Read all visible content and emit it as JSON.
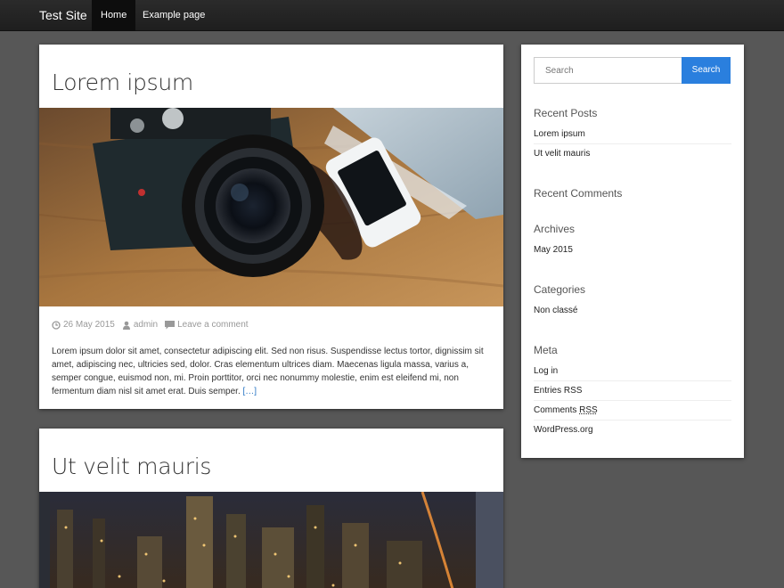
{
  "nav": {
    "brand": "Test Site",
    "items": [
      "Home",
      "Example page"
    ]
  },
  "posts": [
    {
      "title": "Lorem ipsum",
      "date": "26 May 2015",
      "author": "admin",
      "comments": "Leave a comment",
      "excerpt": "Lorem ipsum dolor sit amet, consectetur adipiscing elit. Sed non risus. Suspendisse lectus tortor, dignissim sit amet, adipiscing nec, ultricies sed, dolor. Cras elementum ultrices diam. Maecenas ligula massa, varius a, semper congue, euismod non, mi. Proin porttitor, orci nec nonummy molestie, enim est eleifend mi, non fermentum diam nisl sit amet erat. Duis semper.",
      "more": "[…]"
    },
    {
      "title": "Ut velit mauris"
    }
  ],
  "sidebar": {
    "search_placeholder": "Search",
    "search_button": "Search",
    "recent_posts_title": "Recent Posts",
    "recent_posts": [
      "Lorem ipsum",
      "Ut velit mauris"
    ],
    "recent_comments_title": "Recent Comments",
    "archives_title": "Archives",
    "archives": [
      "May 2015"
    ],
    "categories_title": "Categories",
    "categories": [
      "Non classé"
    ],
    "meta_title": "Meta",
    "meta_links": [
      "Log in",
      "Entries RSS",
      "Comments",
      "RSS",
      "WordPress.org"
    ]
  },
  "colors": {
    "background": "#575757",
    "navbar": "#222222",
    "accent": "#2a7fde",
    "link": "#2a76c4"
  },
  "icons": [
    "clock-icon",
    "user-icon",
    "comment-icon"
  ]
}
